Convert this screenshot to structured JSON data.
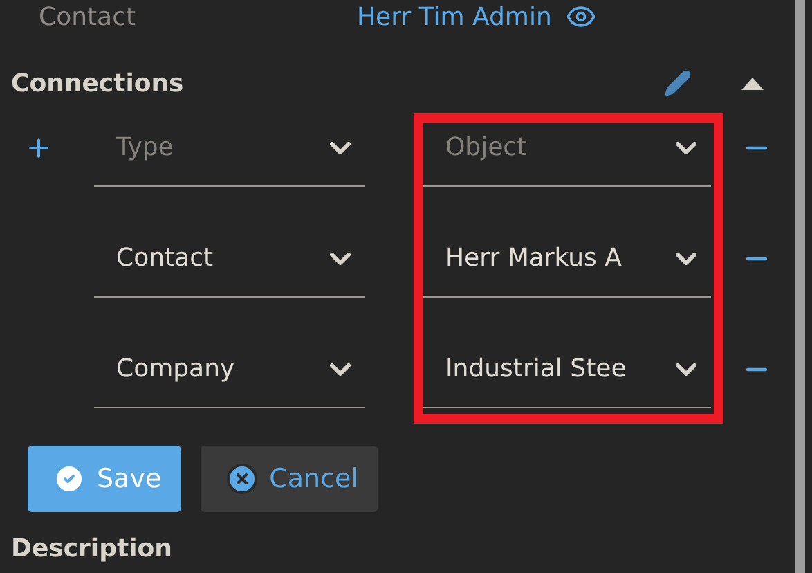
{
  "previous_field": {
    "label": "Contact",
    "value": "Herr Tim Admin"
  },
  "connections": {
    "title": "Connections",
    "expanded": true,
    "rows": [
      {
        "can_add": true,
        "type": {
          "placeholder": "Type"
        },
        "object": {
          "placeholder": "Object"
        }
      },
      {
        "can_add": false,
        "type": {
          "value": "Contact"
        },
        "object": {
          "value": "Herr Markus A"
        }
      },
      {
        "can_add": false,
        "type": {
          "value": "Company"
        },
        "object": {
          "value": "Industrial Stee"
        }
      }
    ],
    "object_column_highlighted": true,
    "buttons": [
      {
        "kind": "save",
        "label": "Save"
      },
      {
        "kind": "cancel",
        "label": "Cancel"
      }
    ]
  },
  "next_section": {
    "title": "Description"
  }
}
